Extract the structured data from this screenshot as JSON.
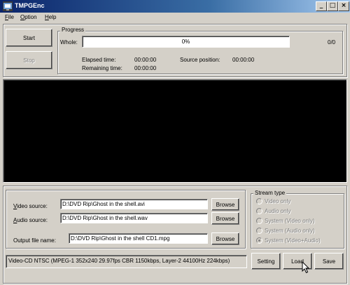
{
  "window": {
    "title": "TMPGEnc",
    "icon": "tmpgenc-app-icon",
    "controls": {
      "minimize": "_",
      "maximize": "□",
      "close": "×"
    }
  },
  "menu": {
    "items": [
      {
        "accel": "F",
        "rest": "ile"
      },
      {
        "accel": "O",
        "rest": "ption"
      },
      {
        "accel": "H",
        "rest": "elp"
      }
    ]
  },
  "progress": {
    "group_title": "Progress",
    "start_label": "Start",
    "stop_label": "Stop",
    "whole_label": "Whole:",
    "percent": "0%",
    "percent_value": 0,
    "count": "0/0",
    "elapsed_label": "Elapsed time:",
    "elapsed_value": "00:00:00",
    "remaining_label": "Remaining time:",
    "remaining_value": "00:00:00",
    "source_position_label": "Source position:",
    "source_position_value": "00:00:00"
  },
  "sources": {
    "video": {
      "accel": "V",
      "rest": "ideo source:",
      "value": "D:\\DVD Rip\\Ghost in the shell.avi",
      "browse": "Browse"
    },
    "audio": {
      "accel": "A",
      "rest": "udio source:",
      "value": "D:\\DVD Rip\\Ghost in the shell.wav",
      "browse": "Browse"
    },
    "output": {
      "label": "Output file name:",
      "value": "D:\\DVD Rip\\Ghost in the shell CD1.mpg",
      "browse": "Browse"
    }
  },
  "stream_type": {
    "title": "Stream type",
    "options": [
      {
        "label": "Video only",
        "checked": false
      },
      {
        "label": "Audio only",
        "checked": false
      },
      {
        "label": "System (Video only)",
        "checked": false
      },
      {
        "label": "System (Audio only)",
        "checked": false
      },
      {
        "label": "System (Video+Audio)",
        "checked": true
      }
    ]
  },
  "status": "Video-CD NTSC (MPEG-1 352x240 29.97fps CBR 1150kbps,  Layer-2 44100Hz 224kbps)",
  "buttons": {
    "setting": "Setting",
    "load": "Load",
    "save": "Save"
  },
  "colors": {
    "face": "#d4d0c8",
    "title_start": "#0a246a",
    "title_end": "#a6caf0",
    "preview": "#000000"
  }
}
